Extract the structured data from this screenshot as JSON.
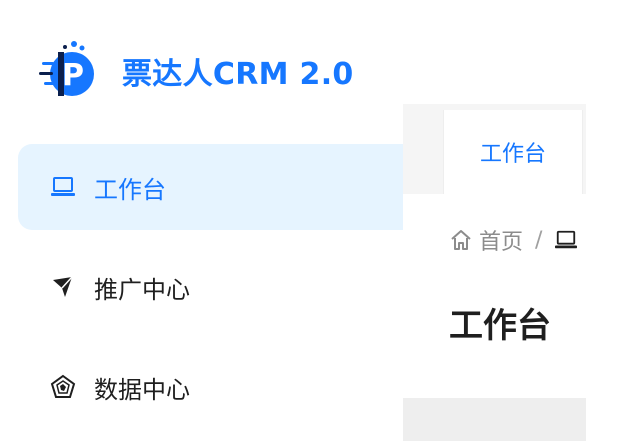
{
  "brand": {
    "title": "票达人CRM 2.0",
    "logo_letter": "P",
    "logo_color": "#1677ff",
    "logo_dark": "#0b1f4d"
  },
  "sidebar": {
    "items": [
      {
        "label": "工作台",
        "icon": "laptop-icon",
        "active": true
      },
      {
        "label": "推广中心",
        "icon": "send-icon",
        "active": false
      },
      {
        "label": "数据中心",
        "icon": "radar-icon",
        "active": false
      }
    ]
  },
  "tabs": [
    {
      "label": "工作台",
      "active": true
    }
  ],
  "breadcrumb": {
    "home": "首页",
    "separator": "/"
  },
  "page": {
    "title": "工作台"
  },
  "colors": {
    "accent": "#1677ff",
    "active_bg": "#e6f4ff",
    "text": "#1f1f1f",
    "muted": "#8c8c8c"
  }
}
